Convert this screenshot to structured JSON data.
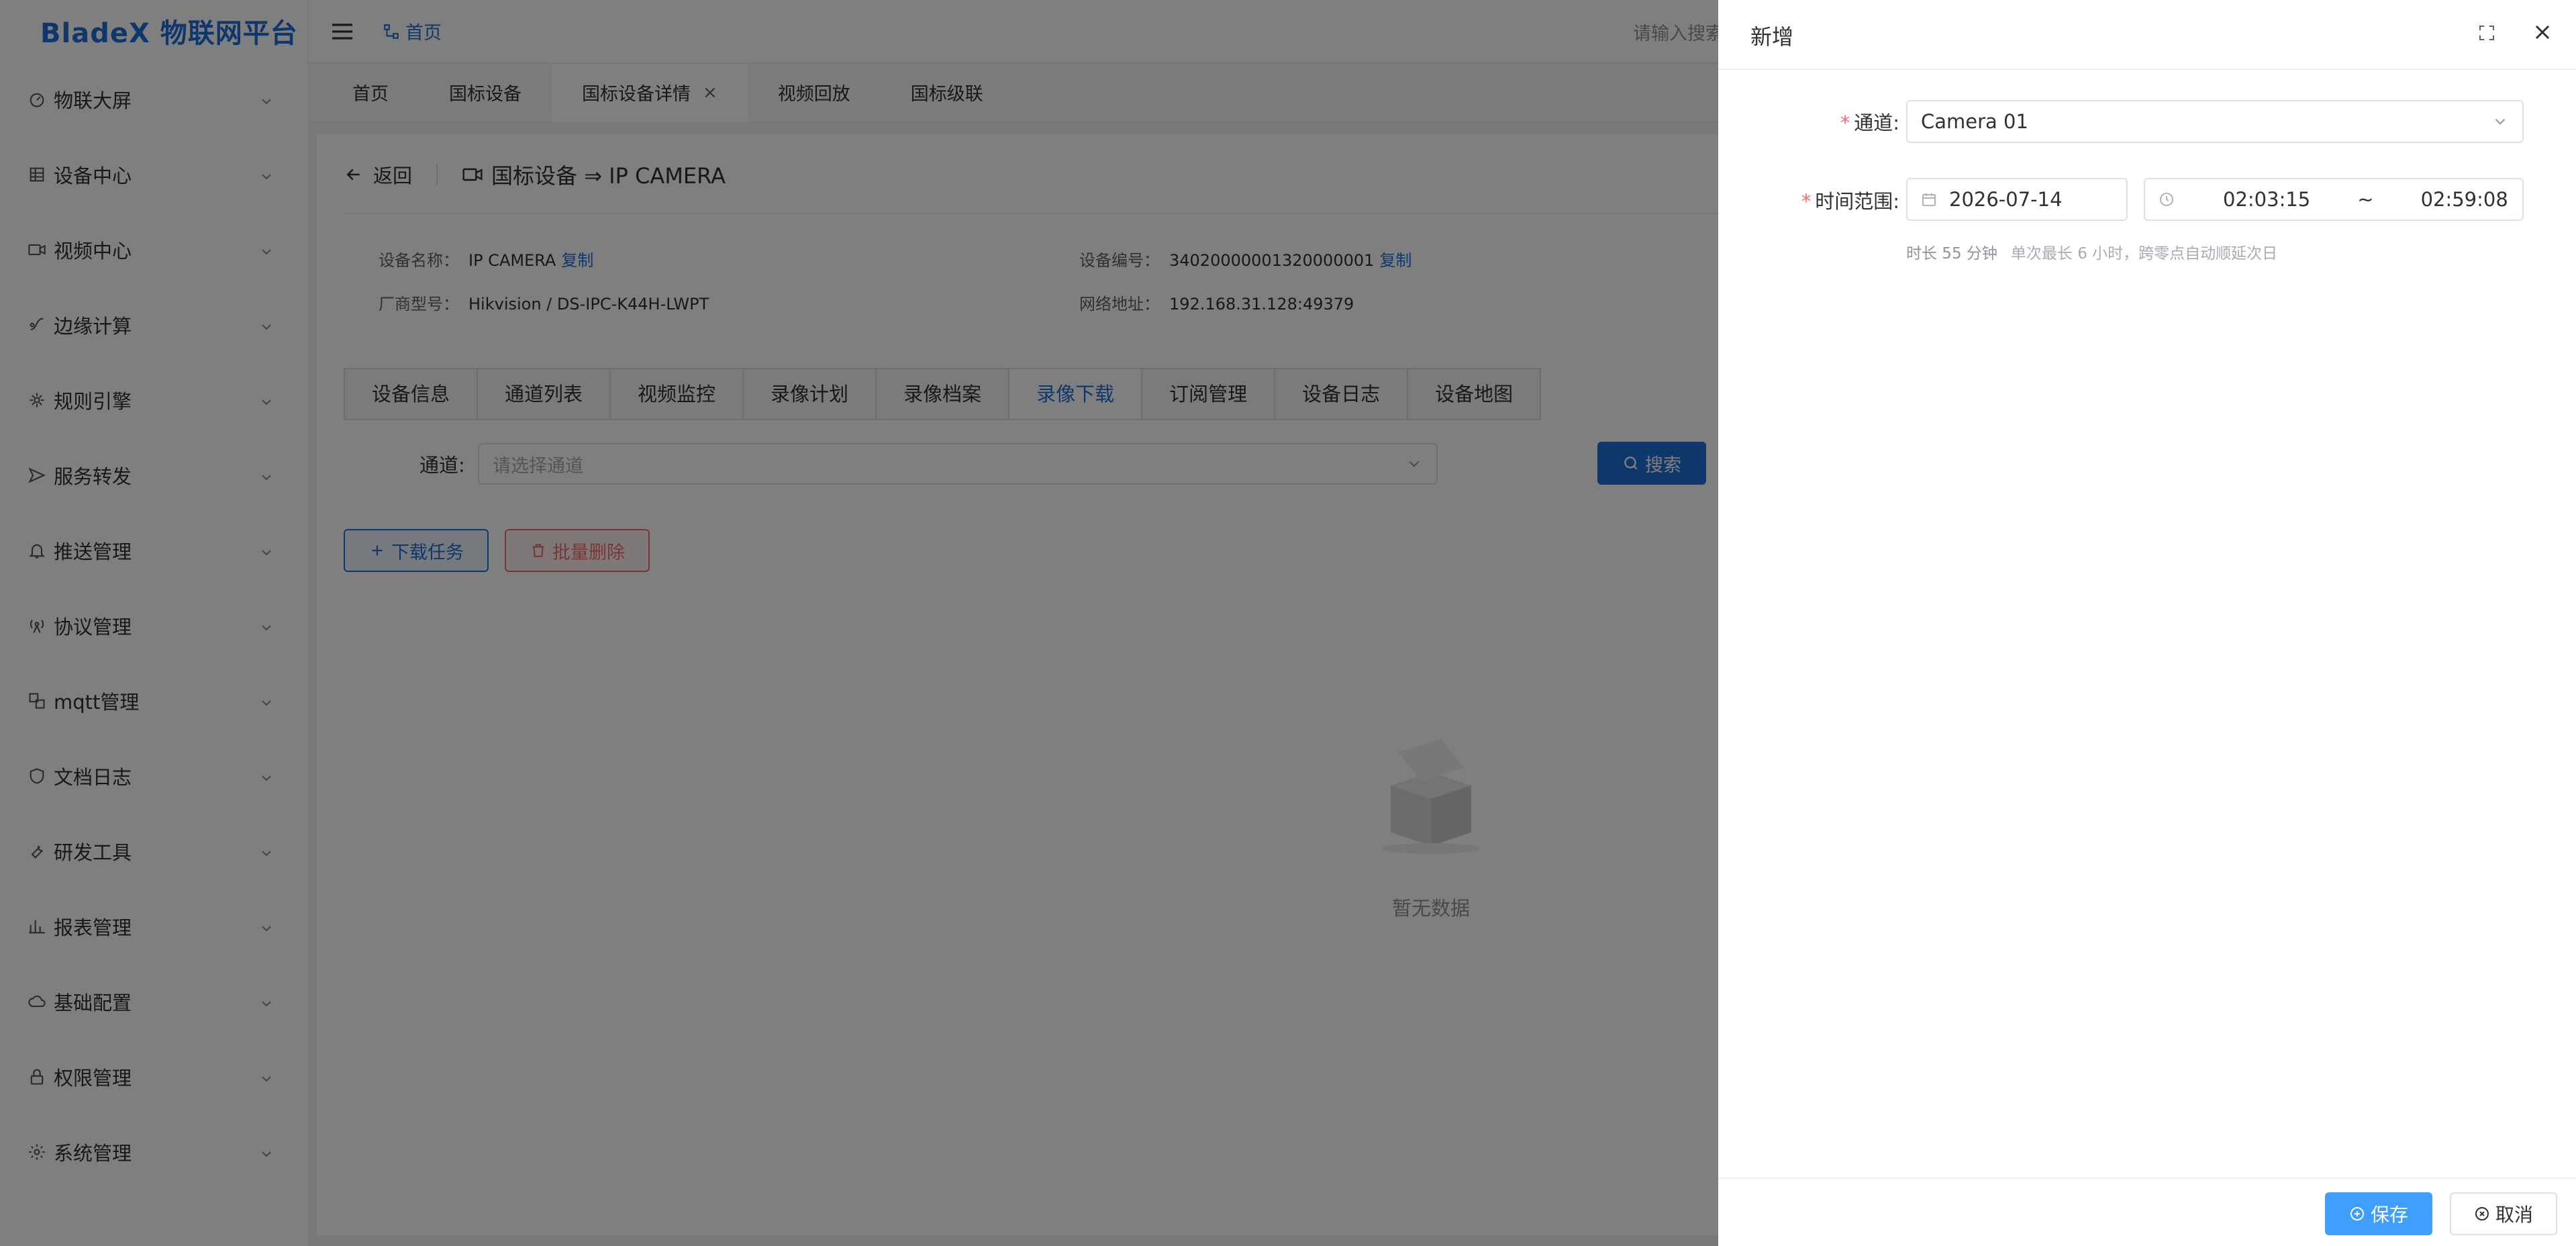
{
  "app": {
    "logo": "BladeX 物联网平台"
  },
  "sidebar": {
    "items": [
      {
        "label": "物联大屏",
        "icon": "dashboard-icon"
      },
      {
        "label": "设备中心",
        "icon": "device-icon"
      },
      {
        "label": "视频中心",
        "icon": "video-icon"
      },
      {
        "label": "边缘计算",
        "icon": "edge-icon"
      },
      {
        "label": "规则引擎",
        "icon": "rule-icon"
      },
      {
        "label": "服务转发",
        "icon": "forward-icon"
      },
      {
        "label": "推送管理",
        "icon": "bell-icon"
      },
      {
        "label": "协议管理",
        "icon": "antenna-icon"
      },
      {
        "label": "mqtt管理",
        "icon": "mqtt-icon"
      },
      {
        "label": "文档日志",
        "icon": "shield-icon"
      },
      {
        "label": "研发工具",
        "icon": "wrench-icon"
      },
      {
        "label": "报表管理",
        "icon": "chart-icon"
      },
      {
        "label": "基础配置",
        "icon": "cloud-icon"
      },
      {
        "label": "权限管理",
        "icon": "lock-icon"
      },
      {
        "label": "系统管理",
        "icon": "gear-icon"
      }
    ]
  },
  "header": {
    "breadcrumb": "首页",
    "search_hint": "请输入搜索"
  },
  "tabs": [
    {
      "label": "首页"
    },
    {
      "label": "国标设备"
    },
    {
      "label": "国标设备详情",
      "closable": true
    },
    {
      "label": "视频回放"
    },
    {
      "label": "国标级联"
    }
  ],
  "detail": {
    "back": "返回",
    "title": "国标设备 ⇒ IP CAMERA",
    "name_label": "设备名称：",
    "name_value": "IP CAMERA",
    "code_label": "设备编号：",
    "code_value": "34020000001320000001",
    "copy": "复制",
    "vendor_label": "厂商型号：",
    "vendor_value": "Hikvision / DS-IPC-K44H-LWPT",
    "addr_label": "网络地址：",
    "addr_value": "192.168.31.128:49379"
  },
  "subtabs": [
    "设备信息",
    "通道列表",
    "视频监控",
    "录像计划",
    "录像档案",
    "录像下载",
    "订阅管理",
    "设备日志",
    "设备地图"
  ],
  "active_subtab": "录像下载",
  "filter": {
    "channel_label": "通道:",
    "channel_placeholder": "请选择通道",
    "search_button": "搜索"
  },
  "actions": {
    "download_task": "下载任务",
    "batch_delete": "批量删除"
  },
  "empty": {
    "text": "暂无数据"
  },
  "drawer": {
    "title": "新增",
    "channel_label": "通道:",
    "channel_value": "Camera 01",
    "time_label": "时间范围:",
    "date": "2026-07-14",
    "time_start": "02:03:15",
    "time_sep": "~",
    "time_end": "02:59:08",
    "duration": "时长 55 分钟",
    "hint": "单次最长 6 小时，跨零点自动顺延次日",
    "save": "保存",
    "cancel": "取消"
  },
  "colors": {
    "primary": "#1e6fd9",
    "danger": "#f56c6c",
    "save": "#409eff"
  }
}
